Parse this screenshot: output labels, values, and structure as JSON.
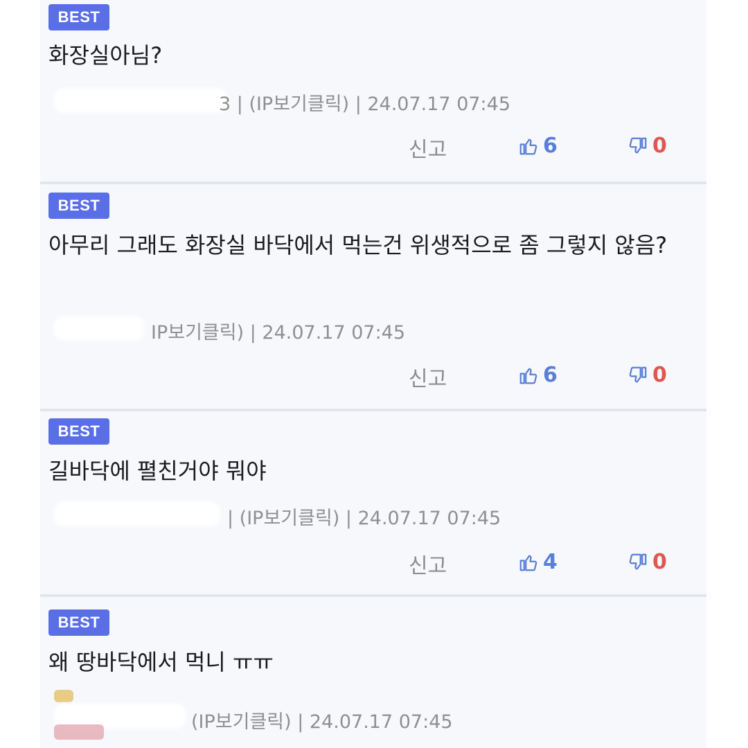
{
  "colors": {
    "badge": "#5a6ee6",
    "like": "#5a7fd6",
    "dislike": "#e0574f",
    "meta": "#8f8f8f"
  },
  "comments": [
    {
      "badge": "BEST",
      "text": "화장실아님?",
      "meta_visible": "3 | (IP보기클릭) | 24.07.17 07:45",
      "report": "신고",
      "likes": "6",
      "dislikes": "0"
    },
    {
      "badge": "BEST",
      "text": "아무리 그래도 화장실 바닥에서 먹는건 위생적으로 좀 그렇지 않음?",
      "meta_visible": "IP보기클릭) | 24.07.17 07:45",
      "report": "신고",
      "likes": "6",
      "dislikes": "0"
    },
    {
      "badge": "BEST",
      "text": "길바닥에 펼친거야 뭐야",
      "meta_visible": "| (IP보기클릭) | 24.07.17 07:45",
      "report": "신고",
      "likes": "4",
      "dislikes": "0"
    },
    {
      "badge": "BEST",
      "text": "왜 땅바닥에서 먹니 ㅠㅠ",
      "meta_visible": "(IP보기클릭) | 24.07.17 07:45"
    }
  ],
  "icons": {
    "like": "thumbs-up-icon",
    "dislike": "thumbs-down-icon"
  }
}
